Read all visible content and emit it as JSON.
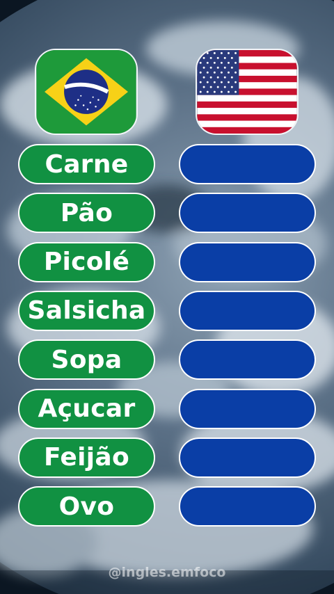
{
  "flags": {
    "left": {
      "icon": "brazil-flag-icon",
      "banner_text": "ORDEM E PROGRESSO"
    },
    "right": {
      "icon": "usa-flag-icon"
    }
  },
  "words": [
    {
      "pt": "Carne",
      "en": ""
    },
    {
      "pt": "Pão",
      "en": ""
    },
    {
      "pt": "Picolé",
      "en": ""
    },
    {
      "pt": "Salsicha",
      "en": ""
    },
    {
      "pt": "Sopa",
      "en": ""
    },
    {
      "pt": "Açucar",
      "en": ""
    },
    {
      "pt": "Feijão",
      "en": ""
    },
    {
      "pt": "Ovo",
      "en": ""
    }
  ],
  "watermark": "@ingles.emfoco",
  "colors": {
    "portuguese_pill": "#119142",
    "english_pill": "#0a3ea6",
    "brazil_green": "#1e9a3a",
    "brazil_yellow": "#f7d117",
    "brazil_blue": "#1e2f86",
    "us_red": "#c8102e",
    "us_blue": "#2a3a7c"
  }
}
